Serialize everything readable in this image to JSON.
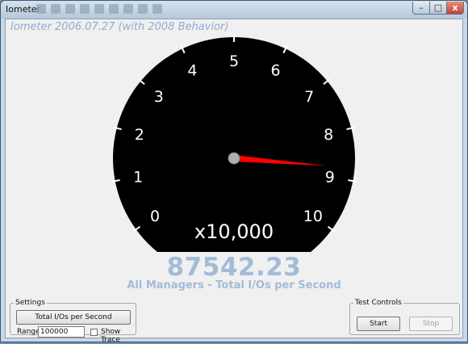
{
  "window": {
    "title": "Iometer",
    "minimize_glyph": "–",
    "maximize_glyph": "□",
    "close_glyph": "x"
  },
  "app_title": "Iometer 2006.07.27 (with 2008 Behavior)",
  "gauge": {
    "scale_labels": [
      "0",
      "1",
      "2",
      "3",
      "4",
      "5",
      "6",
      "7",
      "8",
      "9",
      "10"
    ],
    "multiplier_label": "x10,000",
    "min": 0,
    "max": 10,
    "needle_value": 8.754223,
    "face_color": "#000000",
    "needle_color": "#ff0000",
    "label_color": "#ffffff"
  },
  "readout": {
    "value": "87542.23",
    "label": "All Managers - Total I/Os per Second",
    "color": "#a2bbd8"
  },
  "settings": {
    "group_label": "Settings",
    "metric_button_label": "Total I/Os per Second",
    "range_label": "Range",
    "range_value": "100000",
    "show_trace_label": "Show Trace",
    "show_trace_checked": false
  },
  "test_controls": {
    "group_label": "Test Controls",
    "start_label": "Start",
    "stop_label": "Stop"
  }
}
